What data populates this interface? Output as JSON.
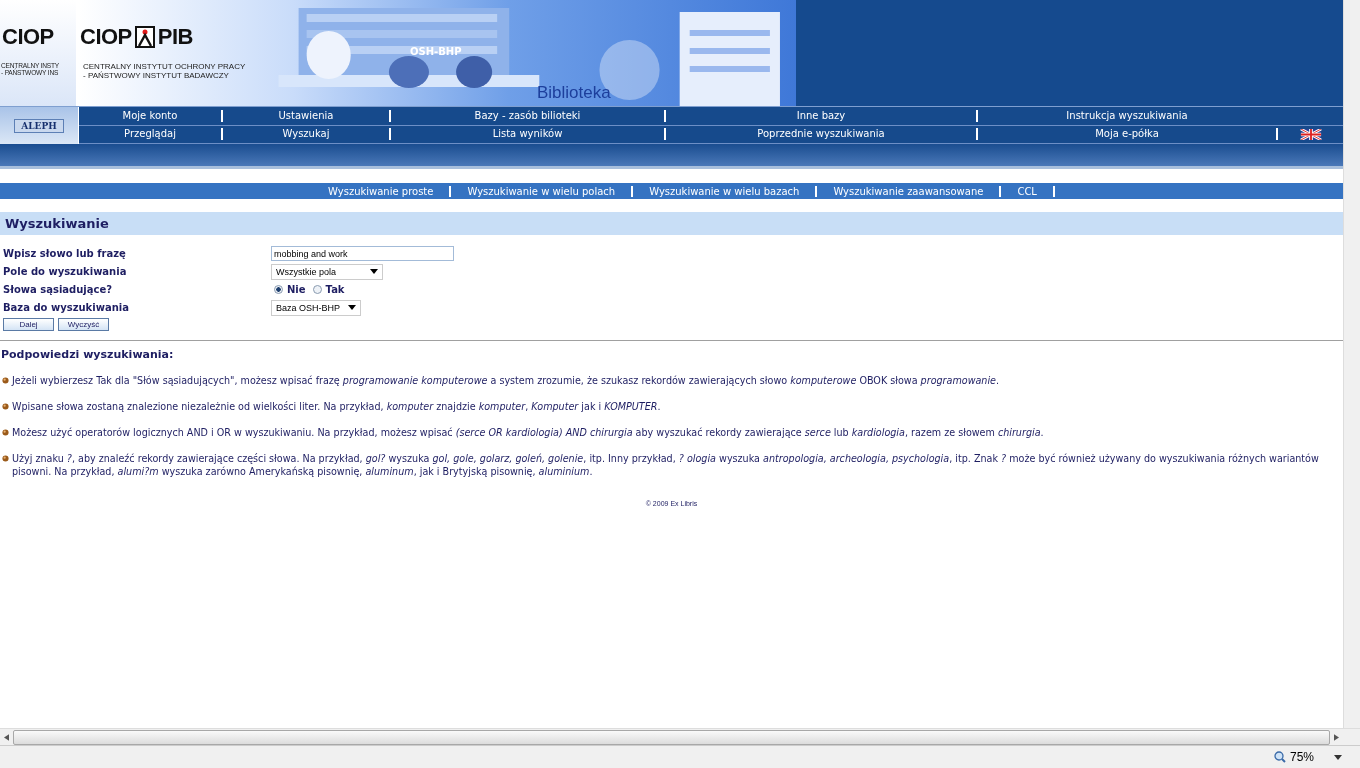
{
  "header": {
    "logo_strip": {
      "mark": "CIOP",
      "line1": "CENTRALNY INSTY",
      "line2": "- PAŃSTWOWY INS"
    },
    "logo": {
      "name_left": "CIOP",
      "name_right": "PIB",
      "line1": "CENTRALNY INSTYTUT OCHRONY PRACY",
      "line2": "- PAŃSTWOWY INSTYTUT BADAWCZY"
    },
    "banner_label": "OSH-BHP",
    "banner_title": "Biblioteka"
  },
  "aleph_logo": "ALEPH",
  "nav_rows": [
    [
      {
        "label": "Moje konto"
      },
      {
        "label": "Ustawienia"
      },
      {
        "label": "Bazy - zasób bilioteki"
      },
      {
        "label": "Inne bazy"
      },
      {
        "label": "Instrukcja wyszukiwania"
      }
    ],
    [
      {
        "label": "Przeglądaj"
      },
      {
        "label": "Wyszukaj"
      },
      {
        "label": "Lista wyników"
      },
      {
        "label": "Poprzednie wyszukiwania"
      },
      {
        "label": "Moja e-półka"
      }
    ]
  ],
  "search_tabs": [
    {
      "label": "Wyszukiwanie proste"
    },
    {
      "label": "Wyszukiwanie w wielu polach"
    },
    {
      "label": "Wyszukiwanie w wielu bazach"
    },
    {
      "label": "Wyszukiwanie zaawansowane"
    },
    {
      "label": "CCL"
    }
  ],
  "section_title": "Wyszukiwanie",
  "form": [
    {
      "kind": "text",
      "label": "Wpisz słowo lub frazę",
      "value": "mobbing and work"
    },
    {
      "kind": "select",
      "label": "Pole do wyszukiwania",
      "value": "Wszystkie pola"
    },
    {
      "kind": "radio",
      "label": "Słowa sąsiadujące?",
      "options": [
        {
          "label": "Nie",
          "selected": true
        },
        {
          "label": "Tak",
          "selected": false
        }
      ]
    },
    {
      "kind": "select",
      "label": "Baza do wyszukiwania",
      "value": "Baza OSH-BHP"
    }
  ],
  "buttons": [
    "Dalej",
    "Wyczyść"
  ],
  "hints_title": "Podpowiedzi wyszukiwania:",
  "hints": [
    "Jeżeli wybierzesz Tak dla \"Słów sąsiadujących\", możesz wpisać frazę *programowanie komputerowe* a system zrozumie, że szukasz rekordów zawierających słowo *komputerowe* OBOK słowa *programowanie*.",
    "Wpisane słowa zostaną znalezione niezależnie od wielkości liter. Na przykład, *komputer* znajdzie *komputer*, *Komputer* jak i *KOMPUTER*.",
    "Możesz użyć operatorów logicznych AND i OR w wyszukiwaniu. Na przykład, możesz wpisać *(serce OR kardiologia) AND chirurgia* aby wyszukać rekordy zawierające *serce* lub *kardiologia*, razem ze słowem *chirurgia*.",
    "Użyj znaku *?*, aby znaleźć rekordy zawierające części słowa. Na przykład, *gol?* wyszuka *gol, gole, golarz, goleń, golenie*, itp. Inny przykład, *? ologia* wyszuka *antropologia, archeologia, psychologia*, itp. Znak *?* może być również używany do wyszukiwania różnych wariantów pisowni. Na przykład, *alumi?m* wyszuka zarówno Amerykańską pisownię, *aluminum*, jak i Brytyjską pisownię, *aluminium*."
  ],
  "footer": "© 2009 Ex Libris",
  "status_bar": {
    "zoom": "75%"
  }
}
